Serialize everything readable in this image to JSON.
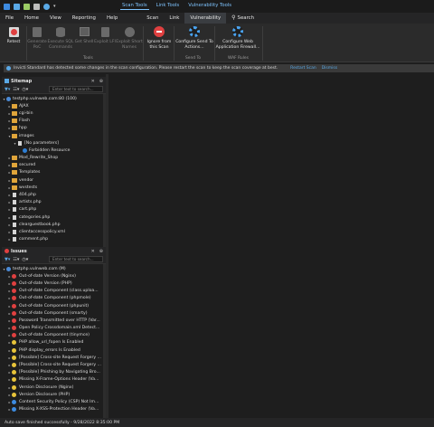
{
  "titlebar": {
    "tools": [
      "Scan Tools",
      "Link Tools",
      "Vulnerability Tools"
    ]
  },
  "menu": {
    "items": [
      "File",
      "Home",
      "View",
      "Reporting",
      "Help"
    ],
    "tabs": [
      "Scan",
      "Link",
      "Vulnerability"
    ],
    "active_tab": "Vulnerability",
    "search_label": "Search"
  },
  "ribbon": {
    "buttons": [
      {
        "label": "Retest",
        "enabled": true,
        "icon": "retest-icon"
      },
      {
        "label": "Generate PoC",
        "enabled": false,
        "icon": "generate-poc-icon"
      },
      {
        "label": "Execute SQL Commands",
        "enabled": false,
        "icon": "sql-icon"
      },
      {
        "label": "Get Shell",
        "enabled": false,
        "icon": "shell-icon"
      },
      {
        "label": "Exploit LFI",
        "enabled": false,
        "icon": "lfi-icon"
      },
      {
        "label": "Exploit Short Names",
        "enabled": false,
        "icon": "short-names-icon"
      },
      {
        "label": "Ignore from this Scan",
        "enabled": true,
        "icon": "ignore-icon"
      },
      {
        "label": "Configure Send To Actions...",
        "enabled": true,
        "icon": "gear-icon"
      },
      {
        "label": "Configure Web Application Firewall...",
        "enabled": true,
        "icon": "gear-icon"
      }
    ],
    "groups": [
      "Tools",
      "Send To",
      "WAF Rules"
    ]
  },
  "infobar": {
    "message": "Invicti Standard has detected some changes in the scan configuration. Please restart the scan to keep the scan coverage at best.",
    "restart_link": "Restart Scan",
    "dismiss_link": "Dismiss"
  },
  "sitemap": {
    "title": "Sitemap",
    "filter_placeholder": "Enter text to search...",
    "root": "testphp.vulnweb.com:80 (100)",
    "items": [
      {
        "label": "AJAX",
        "type": "folder",
        "depth": 1,
        "expand": "collapsed"
      },
      {
        "label": "cgi-bin",
        "type": "folder",
        "depth": 1,
        "expand": "collapsed"
      },
      {
        "label": "Flash",
        "type": "folder",
        "depth": 1,
        "expand": "collapsed"
      },
      {
        "label": "hpp",
        "type": "folder",
        "depth": 1,
        "expand": "collapsed"
      },
      {
        "label": "images",
        "type": "folder",
        "depth": 1,
        "expand": "expanded"
      },
      {
        "label": "[No parameters]",
        "type": "file",
        "depth": 2,
        "expand": "expanded"
      },
      {
        "label": "Forbidden Resource",
        "type": "info",
        "depth": 3,
        "expand": "none"
      },
      {
        "label": "Mod_Rewrite_Shop",
        "type": "folder",
        "depth": 1,
        "expand": "collapsed"
      },
      {
        "label": "secured",
        "type": "folder",
        "depth": 1,
        "expand": "collapsed"
      },
      {
        "label": "Templates",
        "type": "folder",
        "depth": 1,
        "expand": "collapsed"
      },
      {
        "label": "vendor",
        "type": "folder",
        "depth": 1,
        "expand": "collapsed"
      },
      {
        "label": "wvstests",
        "type": "folder",
        "depth": 1,
        "expand": "collapsed"
      },
      {
        "label": "404.php",
        "type": "file",
        "depth": 1,
        "expand": "collapsed"
      },
      {
        "label": "artists.php",
        "type": "file",
        "depth": 1,
        "expand": "collapsed"
      },
      {
        "label": "cart.php",
        "type": "file",
        "depth": 1,
        "expand": "collapsed"
      },
      {
        "label": "categories.php",
        "type": "file",
        "depth": 1,
        "expand": "collapsed"
      },
      {
        "label": "clearguestbook.php",
        "type": "file",
        "depth": 1,
        "expand": "collapsed"
      },
      {
        "label": "clientaccesspolicy.xml",
        "type": "file",
        "depth": 1,
        "expand": "collapsed"
      },
      {
        "label": "comment.php",
        "type": "file",
        "depth": 1,
        "expand": "collapsed"
      }
    ]
  },
  "issues": {
    "title": "Issues",
    "filter_placeholder": "Enter text to search...",
    "root": "testphp.vulnweb.com (M)",
    "items": [
      {
        "label": "Out-of-date Version (Nginx)",
        "sev": "red"
      },
      {
        "label": "Out-of-date Version (PHP)",
        "sev": "red"
      },
      {
        "label": "Out-of-date Component (class.uploa...",
        "sev": "red"
      },
      {
        "label": "Out-of-date Component (phpmole)",
        "sev": "red"
      },
      {
        "label": "Out-of-date Component (phpunit)",
        "sev": "red"
      },
      {
        "label": "Out-of-date Component (smarty)",
        "sev": "red"
      },
      {
        "label": "Password Transmitted over HTTP (Var...",
        "sev": "red"
      },
      {
        "label": "Open Policy Crossdomain.xml Detect...",
        "sev": "red"
      },
      {
        "label": "Out-of-date Component (tinymce)",
        "sev": "red"
      },
      {
        "label": "PHP allow_url_fopen Is Enabled",
        "sev": "yel"
      },
      {
        "label": "PHP display_errors Is Enabled",
        "sev": "yel"
      },
      {
        "label": "[Possible] Cross-site Request Forgery ...",
        "sev": "yel"
      },
      {
        "label": "[Possible] Cross-site Request Forgery ...",
        "sev": "yel"
      },
      {
        "label": "[Possible] Phishing by Navigating Bro...",
        "sev": "yel"
      },
      {
        "label": "Missing X-Frame-Options Header (Va...",
        "sev": "yel"
      },
      {
        "label": "Version Disclosure (Nginx)",
        "sev": "yel"
      },
      {
        "label": "Version Disclosure (PHP)",
        "sev": "yel"
      },
      {
        "label": "Content Security Policy (CSP) Not Im...",
        "sev": "blue"
      },
      {
        "label": "Missing X-XSS-Protection Header (Va...",
        "sev": "blue"
      }
    ]
  },
  "status": {
    "text": "Auto save finished successfully - 9/28/2022 8:35:00 PM"
  },
  "colors": {
    "accent": "#5aa9e6",
    "folder": "#e0a53a",
    "severity_red": "#e04040",
    "severity_yellow": "#e8c43a",
    "severity_blue": "#3d8be0"
  }
}
